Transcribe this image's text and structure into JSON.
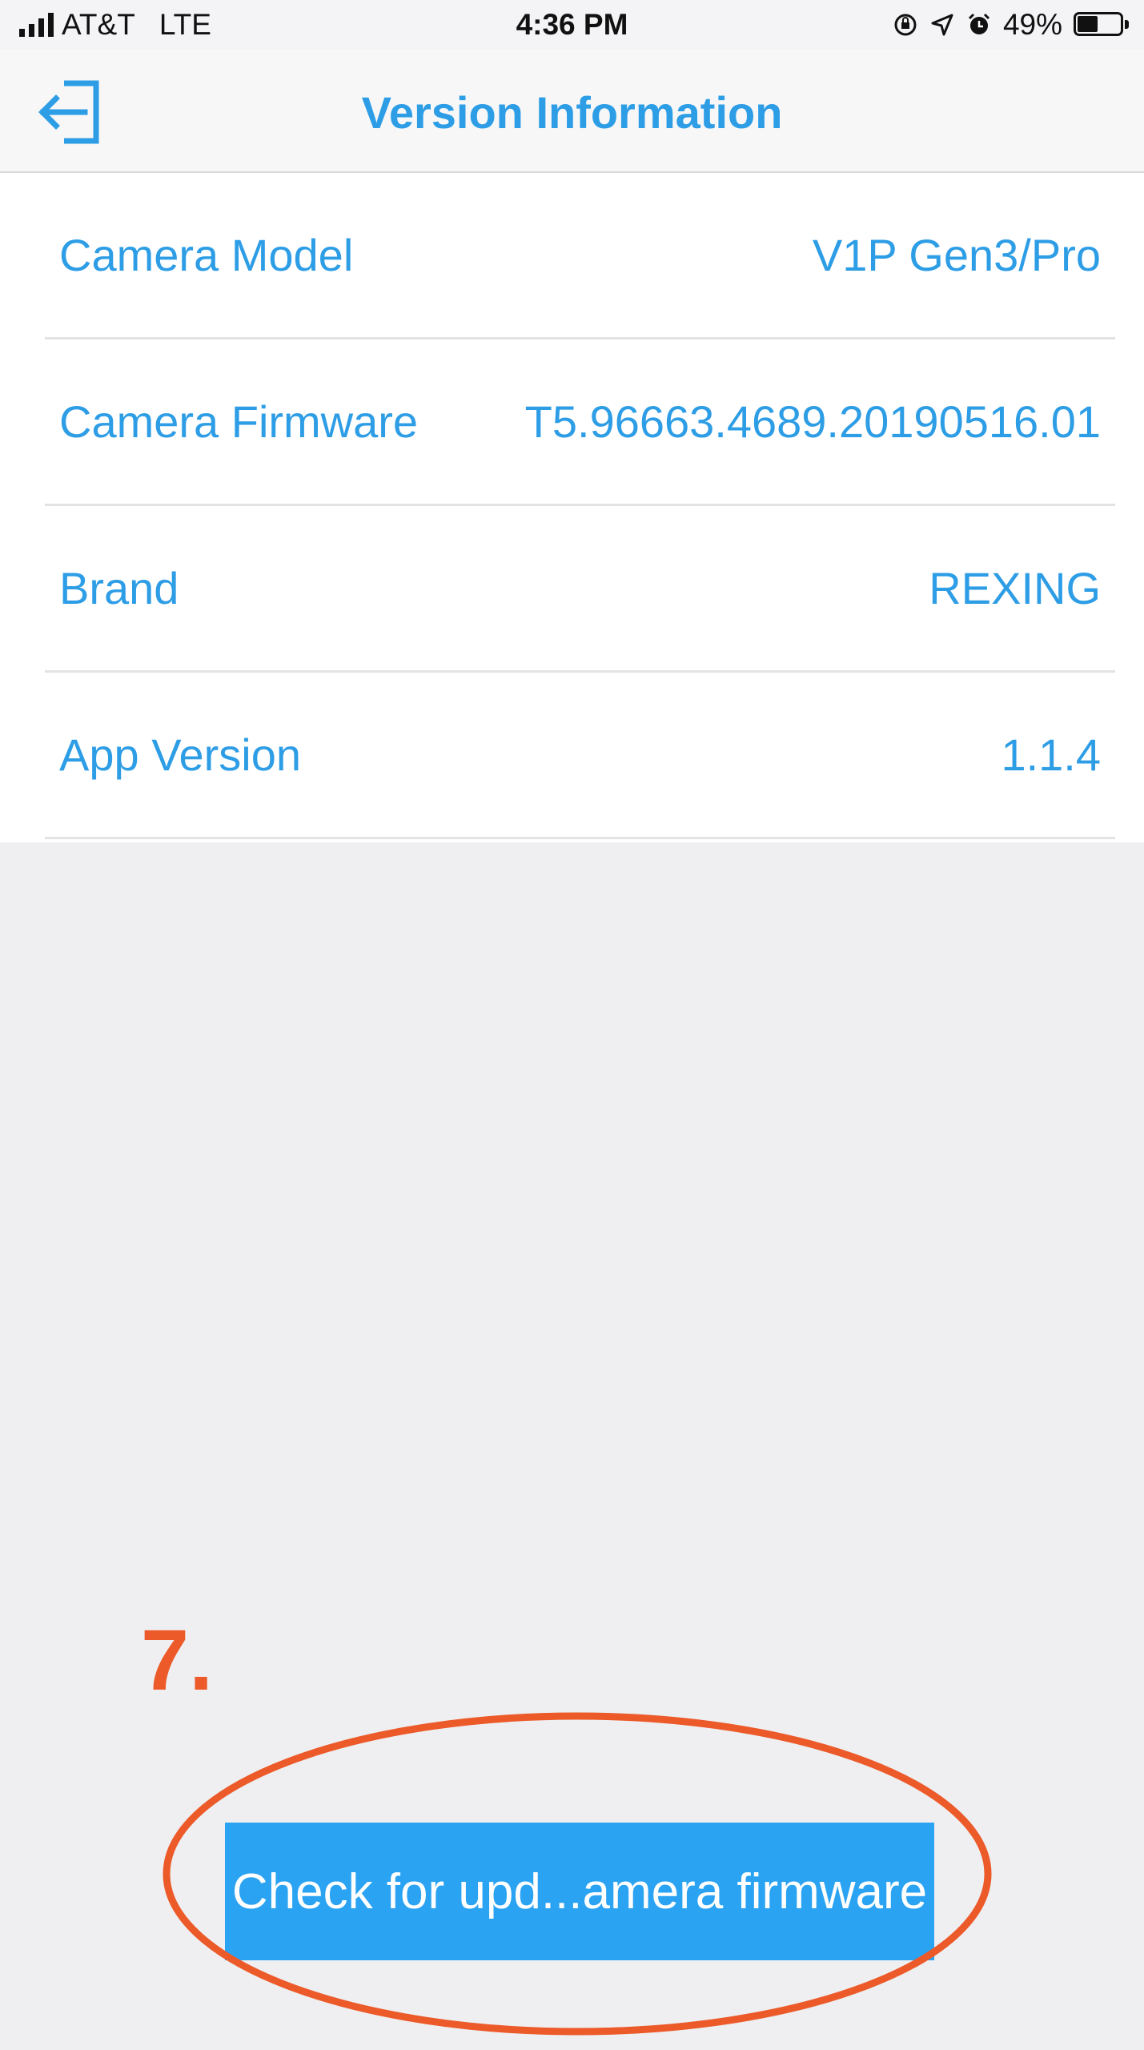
{
  "status_bar": {
    "carrier": "AT&T",
    "network": "LTE",
    "time": "4:36 PM",
    "battery_percent": "49%",
    "battery_level": 0.49,
    "icons": [
      "signal-bars-icon",
      "rotation-lock-icon",
      "location-arrow-icon",
      "alarm-icon",
      "battery-icon"
    ]
  },
  "nav": {
    "title": "Version Information",
    "back_icon": "exit-arrow-icon"
  },
  "info_rows": [
    {
      "label": "Camera Model",
      "value": "V1P Gen3/Pro"
    },
    {
      "label": "Camera Firmware",
      "value": "T5.96663.4689.20190516.01"
    },
    {
      "label": "Brand",
      "value": "REXING"
    },
    {
      "label": "App Version",
      "value": "1.1.4"
    }
  ],
  "annotation": {
    "step_label": "7.",
    "color": "#ec5a2a"
  },
  "update_button": {
    "label": "Check for upd...amera firmware"
  },
  "colors": {
    "accent": "#2d9de6",
    "button": "#2aa3f3",
    "background": "#efeff1"
  }
}
